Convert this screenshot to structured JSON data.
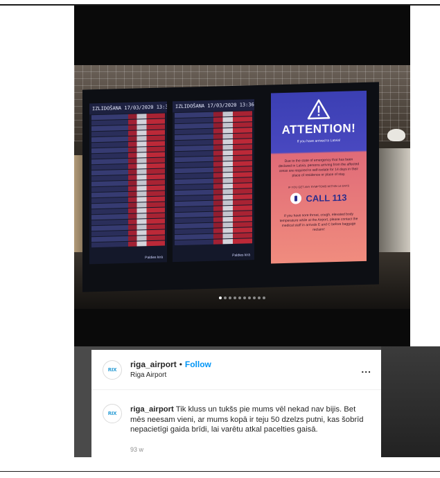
{
  "post": {
    "image": {
      "screen1": {
        "header": "IZLIDOŠANA 17/03/2020 13:36",
        "footer": "Paldies kirā"
      },
      "screen2": {
        "header": "IZLIDOŠANA 17/03/2020 13:36",
        "footer": "Paldies kirā"
      },
      "attention": {
        "title": "ATTENTION!",
        "subtitle": "If you have arrived to Latvia!",
        "body": "Due to the state of emergency that has been declared in Latvia, persons arriving from the affected areas are required to self-isolate for 14 days in their place of residence or place of stay.",
        "note": "IF YOU GET ANY SYMPTOMS WITHIN 14 DAYS",
        "call": "CALL 113",
        "body2": "If you have sore throat, cough, elevated body temperature while at the Airport, please contact the medical staff in arrivals E and C before baggage reclaim!"
      },
      "carousel_count": 10,
      "carousel_active": 0
    },
    "header": {
      "username": "riga_airport",
      "separator": "•",
      "follow_label": "Follow",
      "location": "Riga Airport",
      "more_label": "..."
    },
    "avatar_logo": "RIX",
    "caption": {
      "username": "riga_airport",
      "text": "Tik kluss un tukšs pie mums vēl nekad nav bijis. Bet mēs neesam vieni, ar mums kopā ir teju 50 dzelzs putni, kas šobrīd nepacietīgi gaida brīdi, lai varētu atkal pacelties gaisā."
    },
    "timestamp": "93 w"
  }
}
